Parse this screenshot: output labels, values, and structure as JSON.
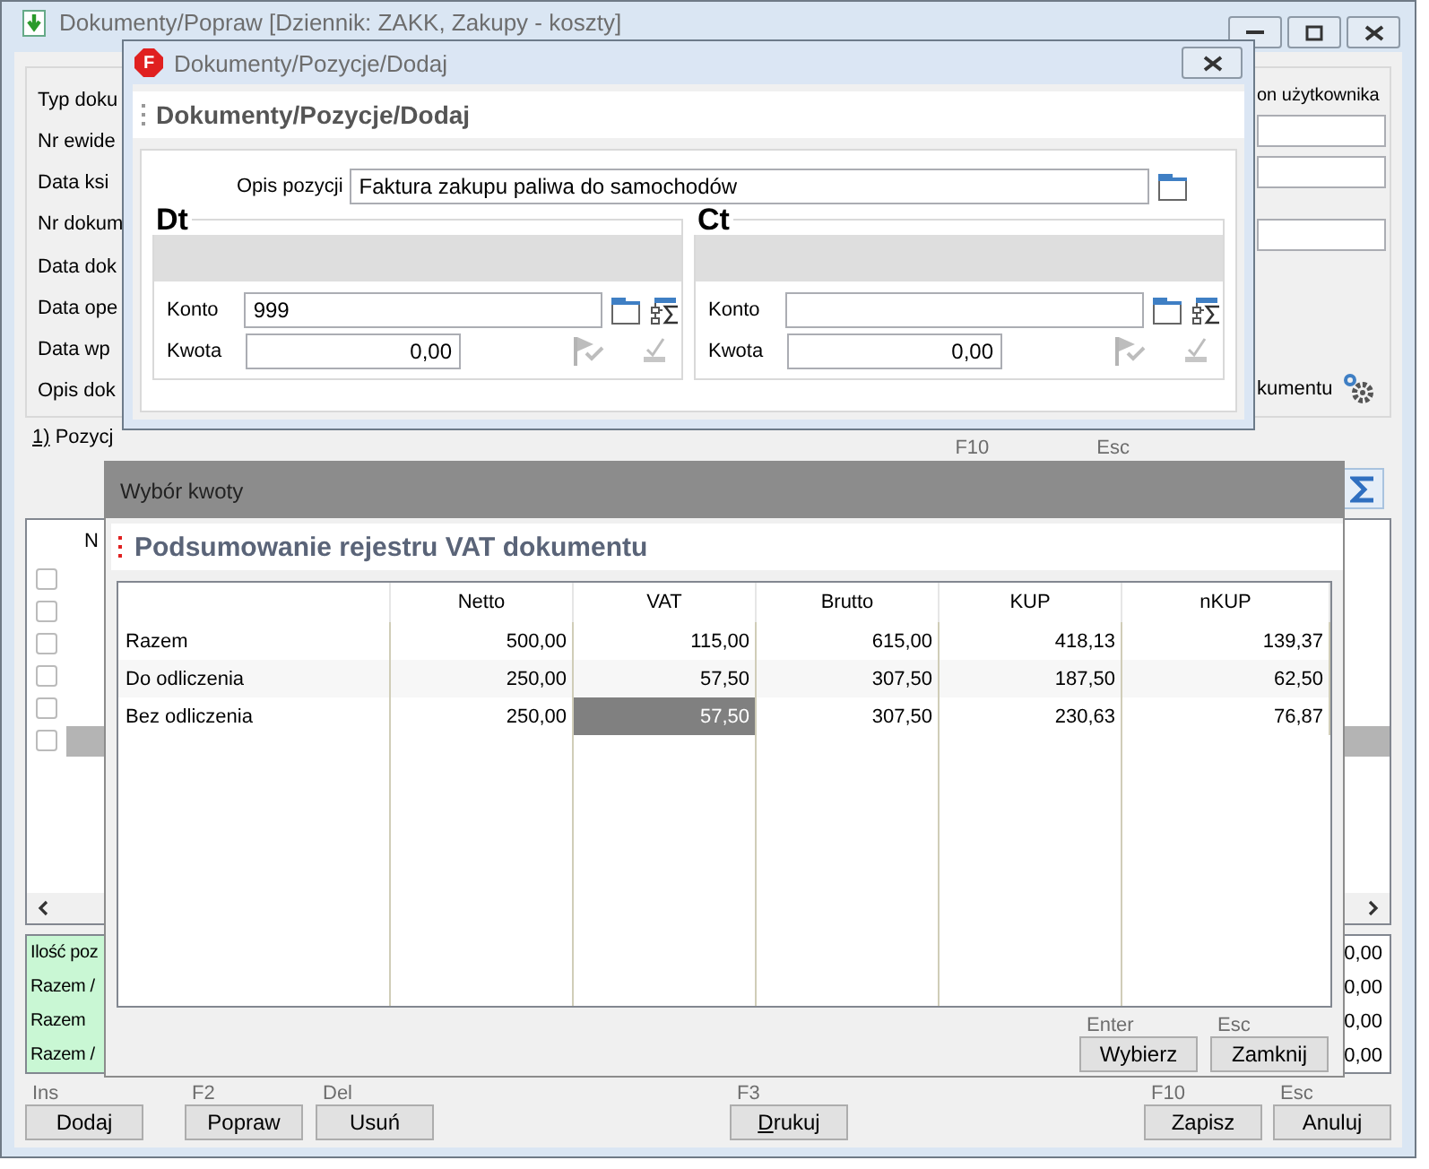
{
  "main_window": {
    "title": "Dokumenty/Popraw [Dziennik: ZAKK, Zakupy - koszty]",
    "form_labels": [
      "Typ doku",
      "Nr ewide",
      "Data ksi",
      "Nr dokum",
      "Data dok",
      "Data ope",
      "Data wp",
      "Opis dok"
    ],
    "user_section_label": "on użytkownika",
    "options_label": "kumentu",
    "tab": {
      "label": "1) Pozycj",
      "accelerator": true
    },
    "hints": [
      "F10",
      "Esc"
    ],
    "list": {
      "column": "N",
      "rows": [
        {
          "checked": false,
          "selected": false
        },
        {
          "checked": false,
          "selected": false
        },
        {
          "checked": false,
          "selected": false
        },
        {
          "checked": false,
          "selected": false
        },
        {
          "checked": false,
          "selected": false
        },
        {
          "checked": false,
          "selected": true
        }
      ]
    },
    "summary": {
      "labels": [
        "Ilość poz",
        "Razem /",
        "Razem",
        "Razem /"
      ],
      "values": [
        "0,00",
        "0,00",
        "0,00",
        "0,00"
      ]
    },
    "buttons": [
      {
        "hint": "Ins",
        "label": "Dodaj",
        "accelerator": false
      },
      {
        "hint": "F2",
        "label": "Popraw",
        "accelerator": false
      },
      {
        "hint": "Del",
        "label": "Usuń",
        "accelerator": false
      },
      {
        "hint": "F3",
        "label": "Drukuj",
        "accelerator": true
      },
      {
        "hint": "F10",
        "label": "Zapisz",
        "accelerator": false
      },
      {
        "hint": "Esc",
        "label": "Anuluj",
        "accelerator": false
      }
    ]
  },
  "position_dialog": {
    "logo": "F",
    "title": "Dokumenty/Pozycje/Dodaj",
    "heading": "Dokumenty/Pozycje/Dodaj",
    "description_label": "Opis pozycji",
    "description": "Faktura zakupu paliwa do samochodów",
    "sides": [
      {
        "heading": "Dt",
        "account_label": "Konto",
        "account": "999",
        "amount_label": "Kwota",
        "amount": "0,00",
        "actions_disabled": true
      },
      {
        "heading": "Ct",
        "account_label": "Konto",
        "amount_label": "Kwota",
        "amount": "0,00",
        "actions_disabled": true
      }
    ]
  },
  "amount_dialog": {
    "title": "Wybór kwoty",
    "heading": "Podsumowanie rejestru VAT dokumentu",
    "columns": [
      "Netto",
      "VAT",
      "Brutto",
      "KUP",
      "nKUP"
    ],
    "rows": [
      {
        "label": "Razem",
        "cells": [
          {
            "text": "500,00",
            "selected": false
          },
          {
            "text": "115,00",
            "selected": false
          },
          {
            "text": "615,00",
            "selected": false
          },
          {
            "text": "418,13",
            "selected": false
          },
          {
            "text": "139,37",
            "selected": false
          }
        ]
      },
      {
        "label": "Do odliczenia",
        "cells": [
          {
            "text": "250,00",
            "selected": false
          },
          {
            "text": "57,50",
            "selected": false
          },
          {
            "text": "307,50",
            "selected": false
          },
          {
            "text": "187,50",
            "selected": false
          },
          {
            "text": "62,50",
            "selected": false
          }
        ]
      },
      {
        "label": "Bez odliczenia",
        "cells": [
          {
            "text": "250,00",
            "selected": false
          },
          {
            "text": "57,50",
            "selected": true
          },
          {
            "text": "307,50",
            "selected": false
          },
          {
            "text": "230,63",
            "selected": false
          },
          {
            "text": "76,87",
            "selected": false
          }
        ]
      }
    ],
    "buttons": [
      {
        "hint": "Enter",
        "label": "Wybierz"
      },
      {
        "hint": "Esc",
        "label": "Zamknij"
      }
    ]
  }
}
